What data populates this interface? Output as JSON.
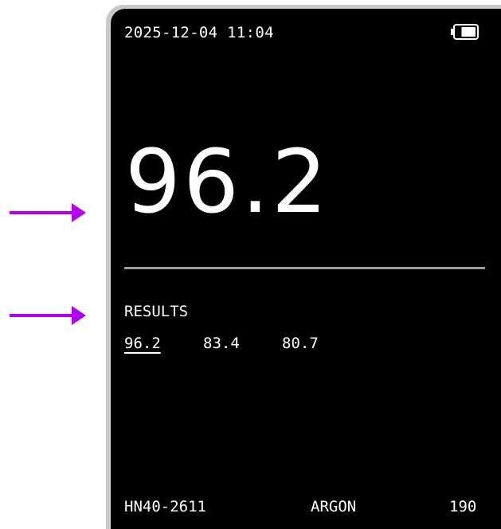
{
  "annotations": {
    "arrow_color": "#b400f0",
    "arrow_icon": "right-arrow"
  },
  "status_bar": {
    "datetime": "2025-12-04 11:04",
    "battery_icon": "battery-icon",
    "battery_level": 0.65
  },
  "display": {
    "main_reading": "96.2",
    "divider_color": "#9c9c9c"
  },
  "results": {
    "heading": "RESULTS",
    "values": [
      "96.2",
      "83.4",
      "80.7"
    ],
    "selected_index": 0
  },
  "footer": {
    "device_id": "HN40-2611",
    "gas": "ARGON",
    "count": "190"
  }
}
